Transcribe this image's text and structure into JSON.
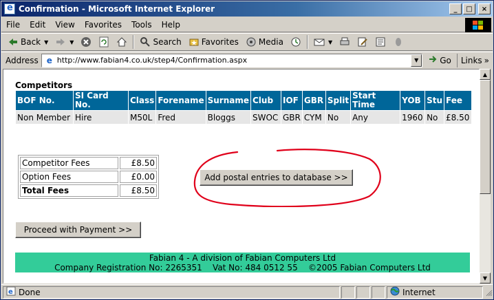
{
  "window": {
    "title": "Confirmation - Microsoft Internet Explorer",
    "minimize": "_",
    "maximize": "□",
    "close": "×"
  },
  "menu": [
    "File",
    "Edit",
    "View",
    "Favorites",
    "Tools",
    "Help"
  ],
  "toolbar": {
    "back": "Back",
    "search": "Search",
    "favorites": "Favorites",
    "media": "Media"
  },
  "address": {
    "label": "Address",
    "url": "http://www.fabian4.co.uk/step4/Confirmation.aspx",
    "go": "Go",
    "links": "Links"
  },
  "page": {
    "section_heading": "Competitors",
    "competitors": {
      "headers": [
        "BOF No.",
        "SI Card No.",
        "Class",
        "Forename",
        "Surname",
        "Club",
        "IOF",
        "GBR",
        "Split",
        "Start Time",
        "YOB",
        "Stu",
        "Fee"
      ],
      "rows": [
        [
          "Non Member",
          "Hire",
          "M50L",
          "Fred",
          "Bloggs",
          "SWOC",
          "GBR",
          "CYM",
          "No",
          "Any",
          "1960",
          "No",
          "£8.50"
        ]
      ]
    },
    "fees": {
      "competitor_label": "Competitor Fees",
      "competitor_value": "£8.50",
      "option_label": "Option Fees",
      "option_value": "£0.00",
      "total_label": "Total Fees",
      "total_value": "£8.50"
    },
    "add_postal_button": "Add postal entries to database >>",
    "proceed_button": "Proceed with Payment >>",
    "footer_line1": "Fabian 4 - A division of Fabian Computers Ltd",
    "footer_line2": "Company Registration No: 2265351    Vat No: 484 0512 55    ©2005 Fabian Computers Ltd"
  },
  "status": {
    "text": "Done",
    "zone": "Internet"
  },
  "colors": {
    "table_header": "#006699",
    "footer_band": "#33cc99",
    "annotation": "#e0001a"
  }
}
